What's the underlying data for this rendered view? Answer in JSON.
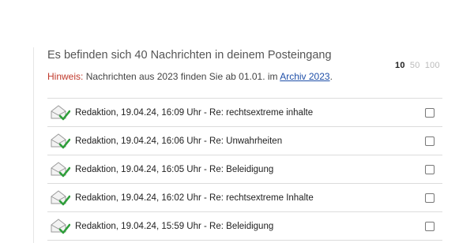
{
  "header": {
    "summary": "Es befinden sich 40 Nachrichten in deinem Posteingang",
    "hint_label": "Hinweis:",
    "hint_text": " Nachrichten aus 2023 finden Sie ab 01.01. im ",
    "hint_link": "Archiv 2023",
    "hint_end": "."
  },
  "page_size": {
    "options": [
      "10",
      "50",
      "100"
    ],
    "selected": "10"
  },
  "messages": [
    {
      "text": "Redaktion, 19.04.24, 16:09 Uhr  -  Re: rechtsextreme inhalte"
    },
    {
      "text": "Redaktion, 19.04.24, 16:06 Uhr  -  Re: Unwahrheiten"
    },
    {
      "text": "Redaktion, 19.04.24, 16:05 Uhr  -  Re: Beleidigung"
    },
    {
      "text": "Redaktion, 19.04.24, 16:02 Uhr  -  Re: rechtsextreme Inhalte"
    },
    {
      "text": "Redaktion, 19.04.24, 15:59 Uhr  -  Re: Beleidigung"
    }
  ],
  "colors": {
    "hint": "#c0392b",
    "link": "#1f4fa8",
    "check": "#2e9e3a"
  },
  "icons": {
    "message": "read-envelope-check-icon"
  }
}
